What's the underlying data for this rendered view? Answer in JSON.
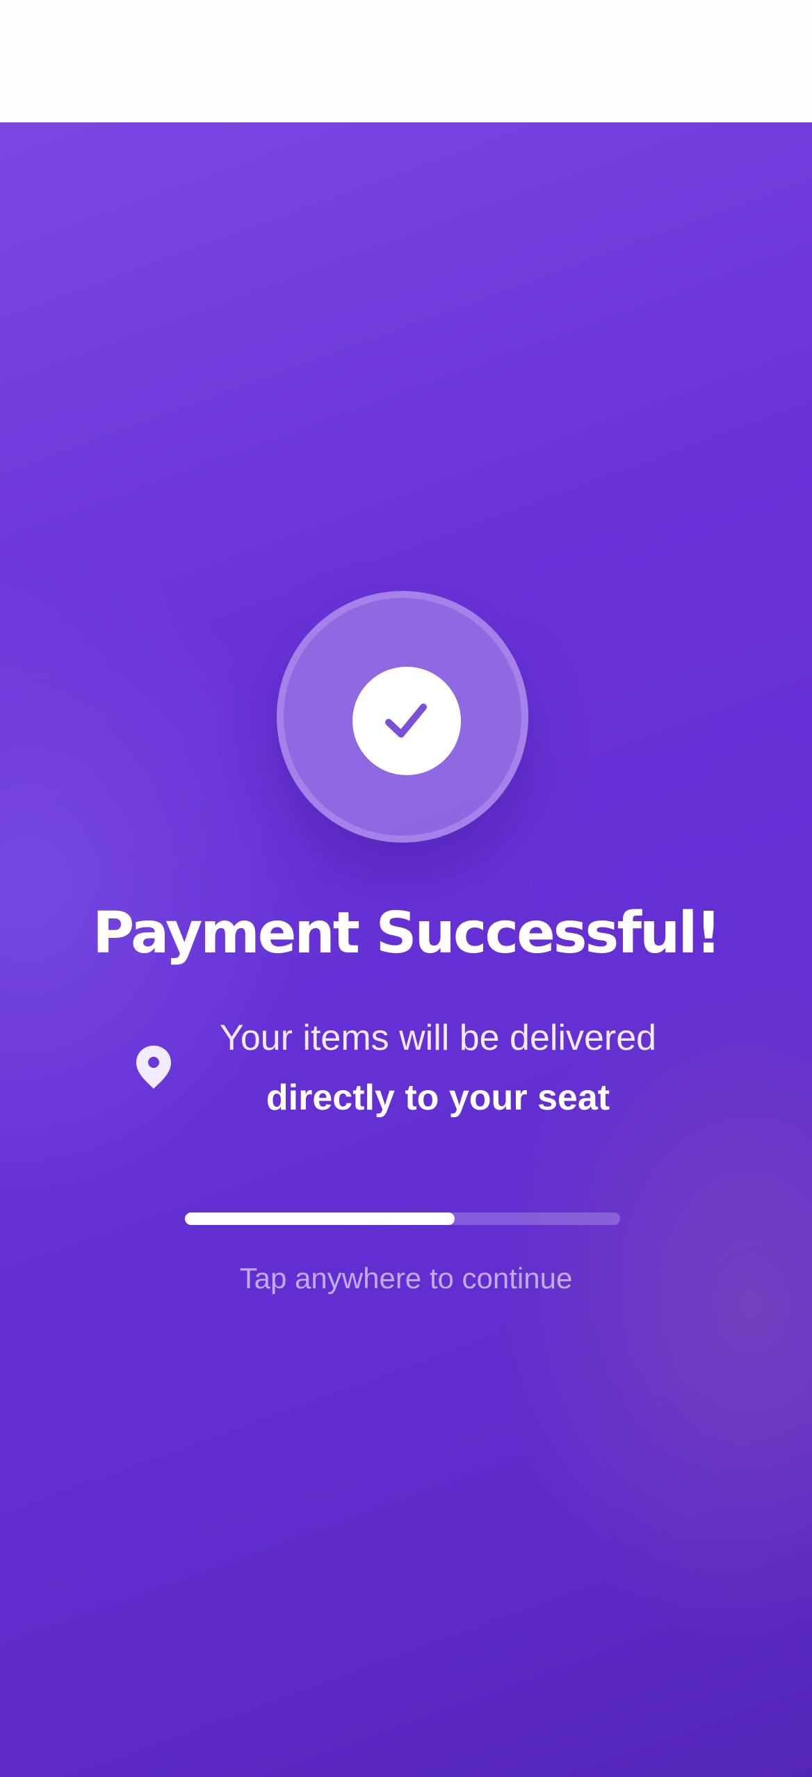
{
  "confirmation": {
    "title": "Payment Successful!",
    "delivery_line_1": "Your items will be delivered",
    "delivery_line_2": "directly to your seat",
    "hint": "Tap anywhere to continue",
    "progress": 0.62
  },
  "icons": {
    "status": "checkmark-icon",
    "location": "map-pin-icon"
  },
  "colors": {
    "background_primary": "#6a33d8",
    "background_accent": "#7a48e3",
    "text": "#ffffff",
    "check_stroke": "#7b4fd6"
  }
}
